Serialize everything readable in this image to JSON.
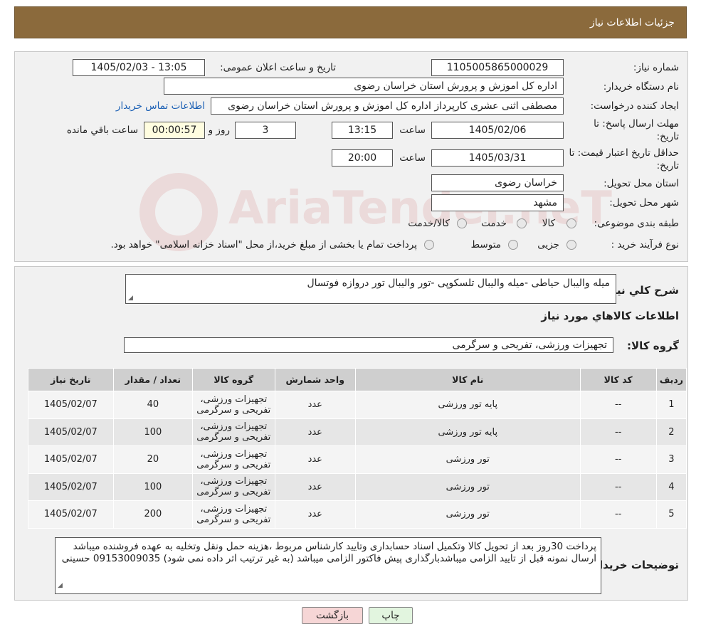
{
  "header": {
    "title": "جزئیات اطلاعات نیاز"
  },
  "watermark": {
    "text": "AriaTender.neT"
  },
  "form": {
    "need_number_label": "شماره نیاز:",
    "need_number": "1105005865000029",
    "announce_label": "تاریخ و ساعت اعلان عمومی:",
    "announce_value": "1405/02/03 - 13:05",
    "buyer_label": "نام دستگاه خریدار:",
    "buyer_value": "اداره کل اموزش و پرورش استان خراسان رضوی",
    "creator_label": "ایجاد کننده درخواست:",
    "creator_value": "مصطفی اثنی عشری کارپرداز اداره کل اموزش و پرورش استان خراسان رضوی",
    "contact_link": "اطلاعات تماس خریدار",
    "deadline_label": "مهلت ارسال پاسخ: تا تاریخ:",
    "deadline_date": "1405/02/06",
    "time_label": "ساعت",
    "deadline_time": "13:15",
    "days_value": "3",
    "days_label": "روز و",
    "remaining_value": "00:00:57",
    "remaining_label": "ساعت باقي مانده",
    "validity_label": "حداقل تاریخ اعتبار قیمت: تا تاریخ:",
    "validity_date": "1405/03/31",
    "validity_time": "20:00",
    "province_label": "استان محل تحویل:",
    "province_value": "خراسان رضوی",
    "city_label": "شهر محل تحویل:",
    "city_value": "مشهد",
    "category_label": "طبقه بندی موضوعی:",
    "category_options": [
      "کالا",
      "خدمت",
      "کالا/خدمت"
    ],
    "process_label": "نوع فرآیند خرید :",
    "process_options": [
      "جزیی",
      "متوسط"
    ],
    "process_note": "پرداخت تمام یا بخشی از مبلغ خرید،از محل \"اسناد خزانه اسلامی\" خواهد بود."
  },
  "summary": {
    "label": "شرح کلي نیاز:",
    "value": "میله والیبال حیاطی -میله والیبال تلسکوپی -تور والیبال تور دروازه فوتسال",
    "items_title": "اطلاعات کالاهاي مورد نیاز",
    "group_label": "گروه کالا:",
    "group_value": "تجهیزات ورزشی، تفریحی و سرگرمی"
  },
  "table": {
    "headers": [
      "ردیف",
      "کد کالا",
      "نام کالا",
      "واحد شمارش",
      "گروه کالا",
      "تعداد / مقدار",
      "تاریخ نیاز"
    ],
    "rows": [
      [
        "1",
        "--",
        "پایه تور ورزشی",
        "عدد",
        "تجهیزات ورزشی، تفریحی و سرگرمی",
        "40",
        "1405/02/07"
      ],
      [
        "2",
        "--",
        "پایه تور ورزشی",
        "عدد",
        "تجهیزات ورزشی، تفریحی و سرگرمی",
        "100",
        "1405/02/07"
      ],
      [
        "3",
        "--",
        "تور ورزشی",
        "عدد",
        "تجهیزات ورزشی، تفریحی و سرگرمی",
        "20",
        "1405/02/07"
      ],
      [
        "4",
        "--",
        "تور ورزشی",
        "عدد",
        "تجهیزات ورزشی، تفریحی و سرگرمی",
        "100",
        "1405/02/07"
      ],
      [
        "5",
        "--",
        "تور ورزشی",
        "عدد",
        "تجهیزات ورزشی، تفریحی و سرگرمی",
        "200",
        "1405/02/07"
      ]
    ]
  },
  "notes": {
    "label": "توضیحات خریدار:",
    "value": "پرداخت 30روز بعد از تحویل کالا وتکمیل اسناد حسابداری وتایید کارشناس مربوط ،هزینه حمل ونقل وتخلیه به عهده فروشنده میباشد ارسال نمونه قبل از تایید الزامی میباشدبارگذاری پیش فاکتور الزامی میباشد (به غیر ترتیب اثر داده نمی شود) 09153009035 حسینی"
  },
  "buttons": {
    "print": "چاپ",
    "back": "بازگشت"
  },
  "colors": {
    "header": "#8b6a3c",
    "back_button": "#f6d6d6",
    "print_button": "#e2f5df"
  }
}
